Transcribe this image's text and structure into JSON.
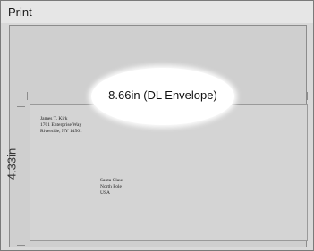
{
  "window": {
    "title": "Print"
  },
  "preview": {
    "width_label": "8.66in (DL Envelope)",
    "height_label": "4.33in"
  },
  "envelope": {
    "return_address": [
      "James T. Kirk",
      "1701 Enterprise Way",
      "Riverside, NY 14561"
    ],
    "recipient_address": [
      "Santa Claus",
      "North Pole",
      "USA"
    ]
  }
}
